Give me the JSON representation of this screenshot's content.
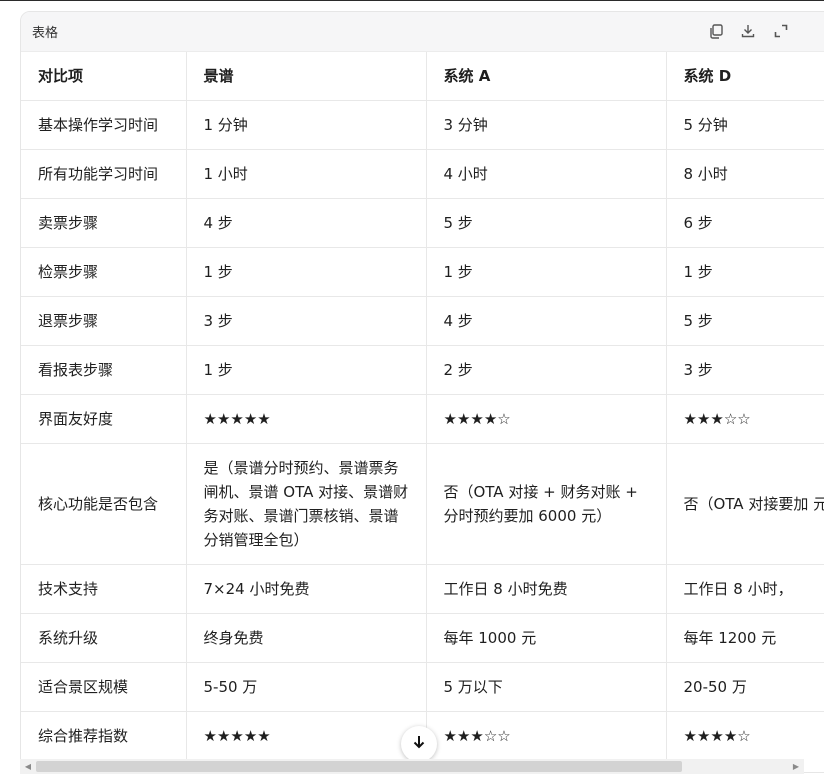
{
  "card": {
    "title": "表格"
  },
  "table": {
    "headers": [
      "对比项",
      "景谱",
      "系统 A",
      "系统 D"
    ],
    "rows": [
      [
        "基本操作学习时间",
        "1 分钟",
        "3 分钟",
        "5 分钟"
      ],
      [
        "所有功能学习时间",
        "1 小时",
        "4 小时",
        "8 小时"
      ],
      [
        "卖票步骤",
        "4 步",
        "5 步",
        "6 步"
      ],
      [
        "检票步骤",
        "1 步",
        "1 步",
        "1 步"
      ],
      [
        "退票步骤",
        "3 步",
        "4 步",
        "5 步"
      ],
      [
        "看报表步骤",
        "1 步",
        "2 步",
        "3 步"
      ],
      [
        "界面友好度",
        "★★★★★",
        "★★★★☆",
        "★★★☆☆"
      ],
      [
        "核心功能是否包含",
        "是（景谱分时预约、景谱票务闸机、景谱 OTA 对接、景谱财务对账、景谱门票核销、景谱分销管理全包）",
        "否（OTA 对接 + 财务对账 + 分时预约要加 6000 元）",
        "否（OTA 对接要加 元）"
      ],
      [
        "技术支持",
        "7×24 小时免费",
        "工作日 8 小时免费",
        "工作日 8 小时，"
      ],
      [
        "系统升级",
        "终身免费",
        "每年 1000 元",
        "每年 1200 元"
      ],
      [
        "适合景区规模",
        "5-50 万",
        "5 万以下",
        "20-50 万"
      ],
      [
        "综合推荐指数",
        "★★★★★",
        "★★★☆☆",
        "★★★★☆"
      ]
    ]
  },
  "icons": {
    "copy": "copy-icon",
    "download": "download-icon",
    "expand": "expand-icon",
    "scroll_down": "arrow-down-icon"
  },
  "colors": {
    "header_bg": "#f6f6f7",
    "border": "#e8e8e8"
  }
}
